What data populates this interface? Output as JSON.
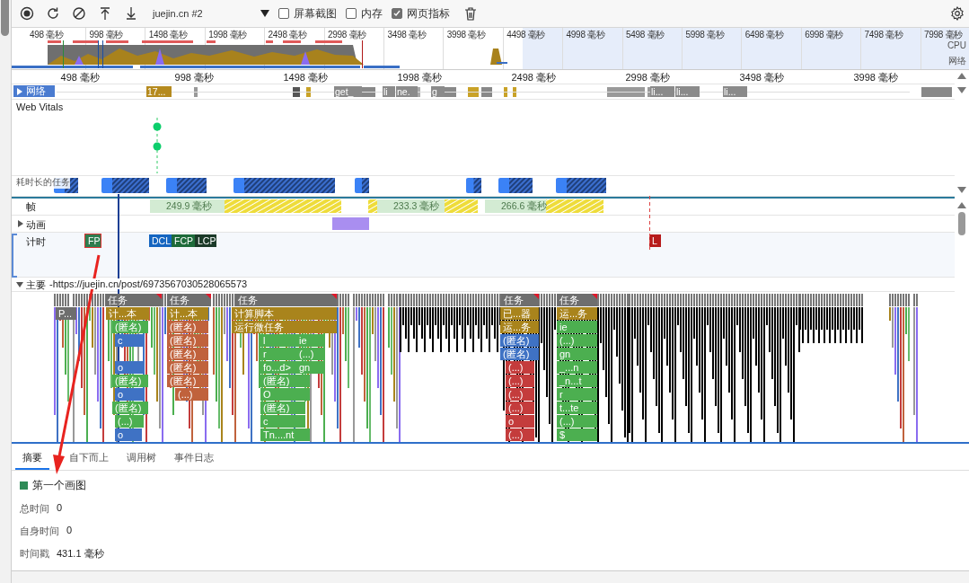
{
  "toolbar": {
    "target": "juejin.cn #2",
    "options": [
      {
        "label": "屏幕截图",
        "checked": false
      },
      {
        "label": "内存",
        "checked": false
      },
      {
        "label": "网页指标",
        "checked": true
      }
    ]
  },
  "overview": {
    "ticks": [
      "498 毫秒",
      "998 毫秒",
      "1498 毫秒",
      "1998 毫秒",
      "2498 毫秒",
      "2998 毫秒",
      "3498 毫秒",
      "3998 毫秒",
      "4498 毫秒",
      "4998 毫秒",
      "5498 毫秒",
      "5998 毫秒",
      "6498 毫秒",
      "6998 毫秒",
      "7498 毫秒",
      "7998 毫秒"
    ],
    "lanes": [
      "CPU",
      "网络"
    ]
  },
  "ruler": {
    "ticks": [
      "498 毫秒",
      "998 毫秒",
      "1498 毫秒",
      "1998 毫秒",
      "2498 毫秒",
      "2998 毫秒",
      "3498 毫秒",
      "3998 毫秒"
    ]
  },
  "tracks": {
    "network": {
      "label": "网络",
      "expanded": false,
      "requests": [
        "17...",
        "get_",
        "li",
        "ne.",
        "g",
        "li...",
        "li...",
        "li..."
      ]
    },
    "web_vitals": {
      "label": "Web Vitals"
    },
    "long_tasks": {
      "label": "耗时长的任务"
    },
    "frames": {
      "label": "帧",
      "segments": [
        "249.9 毫秒",
        "233.3 毫秒",
        "266.6 毫秒"
      ]
    },
    "animations": {
      "label": "动画",
      "expanded": false
    },
    "timings": {
      "label": "计时",
      "markers": [
        {
          "label": "FP",
          "color": "#2e7d4f",
          "selected": true
        },
        {
          "label": "DCL",
          "color": "#1565c0",
          "selected": false
        },
        {
          "label": "FCP",
          "color": "#1e6b3a",
          "selected": false
        },
        {
          "label": "LCP",
          "color": "#1b3a28",
          "selected": false
        },
        {
          "label": "L",
          "color": "#b71c1c",
          "selected": false
        }
      ]
    },
    "main": {
      "label": "主要",
      "url": "-https://juejin.cn/post/6973567030528065573",
      "expanded": true
    }
  },
  "flame_chart": {
    "rows": [
      {
        "blocks": [
          {
            "label": "任务",
            "color": "#6e6e6e",
            "warning": true
          },
          {
            "label": "任务",
            "color": "#6e6e6e",
            "warning": true
          },
          {
            "label": "任务",
            "color": "#6e6e6e",
            "warning": true
          },
          {
            "label": "任务",
            "color": "#6e6e6e",
            "warning": true
          },
          {
            "label": "任务",
            "color": "#6e6e6e",
            "warning": true
          }
        ]
      },
      {
        "blocks": [
          {
            "label": "P...",
            "color": "#6e6e6e",
            "warning": false
          },
          {
            "label": "计...本",
            "color": "#a9841c",
            "warning": false
          },
          {
            "label": "计...本",
            "color": "#a9841c",
            "warning": false
          },
          {
            "label": "计算脚本",
            "color": "#a9841c",
            "warning": false
          },
          {
            "label": "已...器",
            "color": "#a9841c",
            "warning": false
          },
          {
            "label": "运...务",
            "color": "#a9841c",
            "warning": false
          }
        ]
      },
      {
        "blocks": [
          {
            "label": "(匿名)",
            "color": "#4caf50",
            "warning": false
          },
          {
            "label": "(匿名)",
            "color": "#c0623c",
            "warning": false
          },
          {
            "label": "运行微任务",
            "color": "#a9841c",
            "warning": false
          },
          {
            "label": "运...务",
            "color": "#a9841c",
            "warning": false
          },
          {
            "label": "ie",
            "color": "#4caf50",
            "warning": false
          }
        ]
      },
      {
        "blocks": [
          {
            "label": "c",
            "color": "#3f72c4",
            "warning": false
          },
          {
            "label": "(匿名)",
            "color": "#c0623c",
            "warning": false
          },
          {
            "label": "l",
            "color": "#4caf50",
            "warning": false
          },
          {
            "label": "ie",
            "color": "#4caf50",
            "warning": false
          },
          {
            "label": "(匿名)",
            "color": "#3f72c4",
            "warning": false
          },
          {
            "label": "(...)",
            "color": "#4caf50",
            "warning": false
          }
        ]
      },
      {
        "blocks": [
          {
            "label": "(匿名)",
            "color": "#c0623c",
            "warning": false
          },
          {
            "label": "r",
            "color": "#4caf50",
            "warning": false
          },
          {
            "label": "(...)",
            "color": "#4caf50",
            "warning": false
          },
          {
            "label": "(匿名)",
            "color": "#3f72c4",
            "warning": false
          },
          {
            "label": "gn",
            "color": "#4caf50",
            "warning": false
          }
        ]
      },
      {
        "blocks": [
          {
            "label": "o",
            "color": "#3f72c4",
            "warning": false
          },
          {
            "label": "(匿名)",
            "color": "#c0623c",
            "warning": false
          },
          {
            "label": "fo...d>",
            "color": "#4caf50",
            "warning": false
          },
          {
            "label": "gn",
            "color": "#4caf50",
            "warning": false
          },
          {
            "label": "(...)",
            "color": "#c43c3c",
            "warning": false
          },
          {
            "label": "_...n",
            "color": "#4caf50",
            "warning": false
          }
        ]
      },
      {
        "blocks": [
          {
            "label": "(匿名)",
            "color": "#4caf50",
            "warning": false
          },
          {
            "label": "(匿名)",
            "color": "#c0623c",
            "warning": false
          },
          {
            "label": "(匿名)",
            "color": "#4caf50",
            "warning": false
          },
          {
            "label": "(...)",
            "color": "#c43c3c",
            "warning": false
          },
          {
            "label": "_n...t",
            "color": "#4caf50",
            "warning": false
          }
        ]
      },
      {
        "blocks": [
          {
            "label": "o",
            "color": "#3f72c4",
            "warning": false
          },
          {
            "label": "(...)",
            "color": "#c0623c",
            "warning": false
          },
          {
            "label": "O",
            "color": "#4caf50",
            "warning": false
          },
          {
            "label": "(...)",
            "color": "#c43c3c",
            "warning": false
          },
          {
            "label": "r",
            "color": "#4caf50",
            "warning": false
          }
        ]
      },
      {
        "blocks": [
          {
            "label": "(匿名)",
            "color": "#4caf50",
            "warning": false
          },
          {
            "label": "(匿名)",
            "color": "#4caf50",
            "warning": false
          },
          {
            "label": "(...)",
            "color": "#c43c3c",
            "warning": false
          },
          {
            "label": "t...te",
            "color": "#4caf50",
            "warning": false
          }
        ]
      },
      {
        "blocks": [
          {
            "label": "(...)",
            "color": "#4caf50",
            "warning": false
          },
          {
            "label": "c",
            "color": "#4caf50",
            "warning": false
          },
          {
            "label": "o",
            "color": "#c43c3c",
            "warning": false
          },
          {
            "label": "(...)",
            "color": "#4caf50",
            "warning": false
          }
        ]
      },
      {
        "blocks": [
          {
            "label": "o",
            "color": "#3f72c4",
            "warning": false
          },
          {
            "label": "Tn....nt",
            "color": "#4caf50",
            "warning": false
          },
          {
            "label": "(...)",
            "color": "#c43c3c",
            "warning": false
          },
          {
            "label": "$",
            "color": "#4caf50",
            "warning": false
          }
        ]
      }
    ]
  },
  "details": {
    "tabs": [
      {
        "label": "摘要",
        "selected": true
      },
      {
        "label": "自下而上",
        "selected": false
      },
      {
        "label": "调用树",
        "selected": false
      },
      {
        "label": "事件日志",
        "selected": false
      }
    ],
    "summary": {
      "title": "第一个画图",
      "color": "#2e8b57",
      "rows": [
        {
          "label": "总时间",
          "value": "0"
        },
        {
          "label": "自身时间",
          "value": "0"
        },
        {
          "label": "时间戳",
          "value": "431.1 毫秒"
        }
      ]
    }
  }
}
